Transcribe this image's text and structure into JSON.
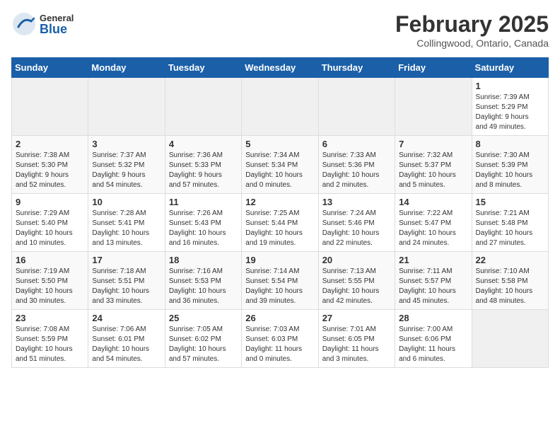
{
  "header": {
    "logo_general": "General",
    "logo_blue": "Blue",
    "month_title": "February 2025",
    "location": "Collingwood, Ontario, Canada"
  },
  "calendar": {
    "days_of_week": [
      "Sunday",
      "Monday",
      "Tuesday",
      "Wednesday",
      "Thursday",
      "Friday",
      "Saturday"
    ],
    "weeks": [
      [
        {
          "day": "",
          "info": ""
        },
        {
          "day": "",
          "info": ""
        },
        {
          "day": "",
          "info": ""
        },
        {
          "day": "",
          "info": ""
        },
        {
          "day": "",
          "info": ""
        },
        {
          "day": "",
          "info": ""
        },
        {
          "day": "1",
          "info": "Sunrise: 7:39 AM\nSunset: 5:29 PM\nDaylight: 9 hours\nand 49 minutes."
        }
      ],
      [
        {
          "day": "2",
          "info": "Sunrise: 7:38 AM\nSunset: 5:30 PM\nDaylight: 9 hours\nand 52 minutes."
        },
        {
          "day": "3",
          "info": "Sunrise: 7:37 AM\nSunset: 5:32 PM\nDaylight: 9 hours\nand 54 minutes."
        },
        {
          "day": "4",
          "info": "Sunrise: 7:36 AM\nSunset: 5:33 PM\nDaylight: 9 hours\nand 57 minutes."
        },
        {
          "day": "5",
          "info": "Sunrise: 7:34 AM\nSunset: 5:34 PM\nDaylight: 10 hours\nand 0 minutes."
        },
        {
          "day": "6",
          "info": "Sunrise: 7:33 AM\nSunset: 5:36 PM\nDaylight: 10 hours\nand 2 minutes."
        },
        {
          "day": "7",
          "info": "Sunrise: 7:32 AM\nSunset: 5:37 PM\nDaylight: 10 hours\nand 5 minutes."
        },
        {
          "day": "8",
          "info": "Sunrise: 7:30 AM\nSunset: 5:39 PM\nDaylight: 10 hours\nand 8 minutes."
        }
      ],
      [
        {
          "day": "9",
          "info": "Sunrise: 7:29 AM\nSunset: 5:40 PM\nDaylight: 10 hours\nand 10 minutes."
        },
        {
          "day": "10",
          "info": "Sunrise: 7:28 AM\nSunset: 5:41 PM\nDaylight: 10 hours\nand 13 minutes."
        },
        {
          "day": "11",
          "info": "Sunrise: 7:26 AM\nSunset: 5:43 PM\nDaylight: 10 hours\nand 16 minutes."
        },
        {
          "day": "12",
          "info": "Sunrise: 7:25 AM\nSunset: 5:44 PM\nDaylight: 10 hours\nand 19 minutes."
        },
        {
          "day": "13",
          "info": "Sunrise: 7:24 AM\nSunset: 5:46 PM\nDaylight: 10 hours\nand 22 minutes."
        },
        {
          "day": "14",
          "info": "Sunrise: 7:22 AM\nSunset: 5:47 PM\nDaylight: 10 hours\nand 24 minutes."
        },
        {
          "day": "15",
          "info": "Sunrise: 7:21 AM\nSunset: 5:48 PM\nDaylight: 10 hours\nand 27 minutes."
        }
      ],
      [
        {
          "day": "16",
          "info": "Sunrise: 7:19 AM\nSunset: 5:50 PM\nDaylight: 10 hours\nand 30 minutes."
        },
        {
          "day": "17",
          "info": "Sunrise: 7:18 AM\nSunset: 5:51 PM\nDaylight: 10 hours\nand 33 minutes."
        },
        {
          "day": "18",
          "info": "Sunrise: 7:16 AM\nSunset: 5:53 PM\nDaylight: 10 hours\nand 36 minutes."
        },
        {
          "day": "19",
          "info": "Sunrise: 7:14 AM\nSunset: 5:54 PM\nDaylight: 10 hours\nand 39 minutes."
        },
        {
          "day": "20",
          "info": "Sunrise: 7:13 AM\nSunset: 5:55 PM\nDaylight: 10 hours\nand 42 minutes."
        },
        {
          "day": "21",
          "info": "Sunrise: 7:11 AM\nSunset: 5:57 PM\nDaylight: 10 hours\nand 45 minutes."
        },
        {
          "day": "22",
          "info": "Sunrise: 7:10 AM\nSunset: 5:58 PM\nDaylight: 10 hours\nand 48 minutes."
        }
      ],
      [
        {
          "day": "23",
          "info": "Sunrise: 7:08 AM\nSunset: 5:59 PM\nDaylight: 10 hours\nand 51 minutes."
        },
        {
          "day": "24",
          "info": "Sunrise: 7:06 AM\nSunset: 6:01 PM\nDaylight: 10 hours\nand 54 minutes."
        },
        {
          "day": "25",
          "info": "Sunrise: 7:05 AM\nSunset: 6:02 PM\nDaylight: 10 hours\nand 57 minutes."
        },
        {
          "day": "26",
          "info": "Sunrise: 7:03 AM\nSunset: 6:03 PM\nDaylight: 11 hours\nand 0 minutes."
        },
        {
          "day": "27",
          "info": "Sunrise: 7:01 AM\nSunset: 6:05 PM\nDaylight: 11 hours\nand 3 minutes."
        },
        {
          "day": "28",
          "info": "Sunrise: 7:00 AM\nSunset: 6:06 PM\nDaylight: 11 hours\nand 6 minutes."
        },
        {
          "day": "",
          "info": ""
        }
      ]
    ]
  }
}
